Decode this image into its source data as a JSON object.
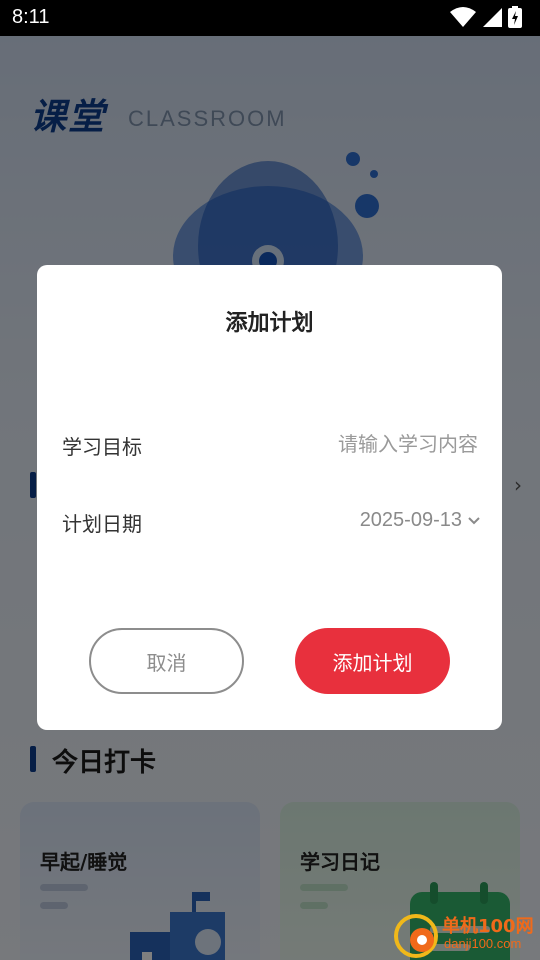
{
  "status_bar": {
    "time": "8:11"
  },
  "page": {
    "brand_title": "课堂",
    "brand_subtitle": "CLASSROOM",
    "section_today": "今日打卡",
    "cards": [
      {
        "title": "早起/睡觉"
      },
      {
        "title": "学习日记"
      }
    ]
  },
  "dialog": {
    "title": "添加计划",
    "goal_label": "学习目标",
    "goal_placeholder": "请输入学习内容",
    "goal_value": "",
    "date_label": "计划日期",
    "date_value": "2025-09-13",
    "cancel_label": "取消",
    "confirm_label": "添加计划"
  },
  "watermark": {
    "text": "单机100网",
    "sub": "danji100.com"
  },
  "colors": {
    "accent": "#e8303d",
    "brand": "#0d3c8c",
    "overlay": "#000000"
  }
}
